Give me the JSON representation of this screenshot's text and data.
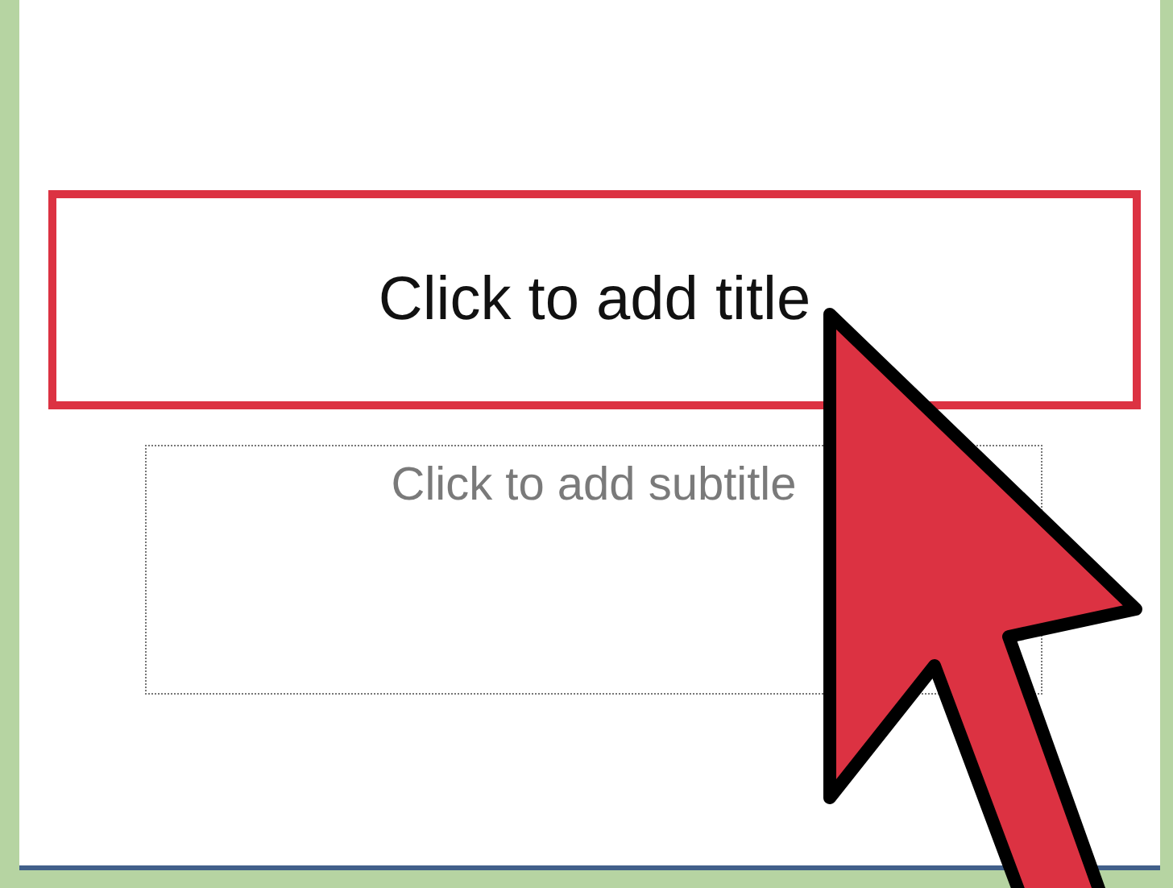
{
  "slide": {
    "title": {
      "placeholder": "Click to add title",
      "selected": true
    },
    "subtitle": {
      "placeholder": "Click to add subtitle",
      "selected": false
    }
  }
}
